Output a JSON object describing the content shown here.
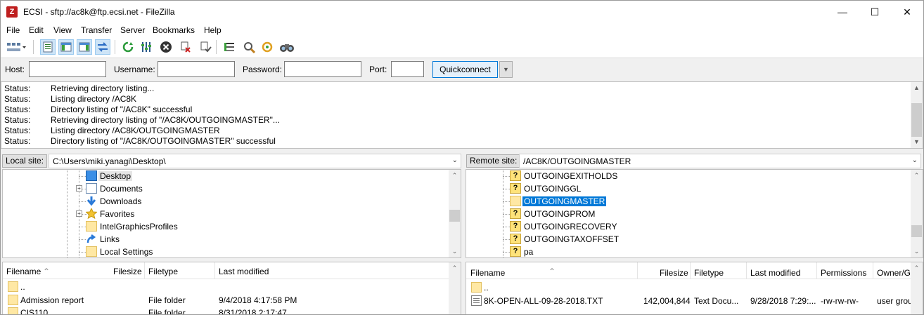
{
  "window": {
    "title": "ECSI - sftp://ac8k@ftp.ecsi.net - FileZilla",
    "app_icon": "Z"
  },
  "menu": [
    "File",
    "Edit",
    "View",
    "Transfer",
    "Server",
    "Bookmarks",
    "Help"
  ],
  "quickconnect": {
    "host_label": "Host:",
    "host_value": "",
    "user_label": "Username:",
    "user_value": "",
    "pass_label": "Password:",
    "pass_value": "",
    "port_label": "Port:",
    "port_value": "",
    "button": "Quickconnect"
  },
  "log": [
    {
      "k": "Status:",
      "v": "Retrieving directory listing..."
    },
    {
      "k": "Status:",
      "v": "Listing directory /AC8K"
    },
    {
      "k": "Status:",
      "v": "Directory listing of \"/AC8K\" successful"
    },
    {
      "k": "Status:",
      "v": "Retrieving directory listing of \"/AC8K/OUTGOINGMASTER\"..."
    },
    {
      "k": "Status:",
      "v": "Listing directory /AC8K/OUTGOINGMASTER"
    },
    {
      "k": "Status:",
      "v": "Directory listing of \"/AC8K/OUTGOINGMASTER\" successful"
    }
  ],
  "local": {
    "site_label": "Local site:",
    "path": "C:\\Users\\miki.yanagi\\Desktop\\",
    "tree": [
      "Desktop",
      "Documents",
      "Downloads",
      "Favorites",
      "IntelGraphicsProfiles",
      "Links",
      "Local Settings"
    ],
    "columns": {
      "name": "Filename",
      "size": "Filesize",
      "type": "Filetype",
      "modified": "Last modified"
    },
    "files": [
      {
        "name": "..",
        "type": "",
        "modified": ""
      },
      {
        "name": "Admission report",
        "type": "File folder",
        "modified": "9/4/2018 4:17:58 PM"
      },
      {
        "name": "CIS110",
        "type": "File folder",
        "modified": "8/31/2018 2:17:47"
      }
    ]
  },
  "remote": {
    "site_label": "Remote site:",
    "path": "/AC8K/OUTGOINGMASTER",
    "tree": [
      "OUTGOINGEXITHOLDS",
      "OUTGOINGGL",
      "OUTGOINGMASTER",
      "OUTGOINGPROM",
      "OUTGOINGRECOVERY",
      "OUTGOINGTAXOFFSET",
      "pa"
    ],
    "tree_icon_mark": "?",
    "columns": {
      "name": "Filename",
      "size": "Filesize",
      "type": "Filetype",
      "modified": "Last modified",
      "perms": "Permissions",
      "owner": "Owner/Gro"
    },
    "files": [
      {
        "name": "..",
        "size": "",
        "type": "",
        "modified": "",
        "perms": "",
        "owner": ""
      },
      {
        "name": "8K-OPEN-ALL-09-28-2018.TXT",
        "size": "142,004,844",
        "type": "Text Docu...",
        "modified": "9/28/2018 7:29:...",
        "perms": "-rw-rw-rw-",
        "owner": "user group"
      }
    ]
  },
  "colors": {
    "selection": "#0078d7",
    "folder": "#ffe8a4"
  }
}
